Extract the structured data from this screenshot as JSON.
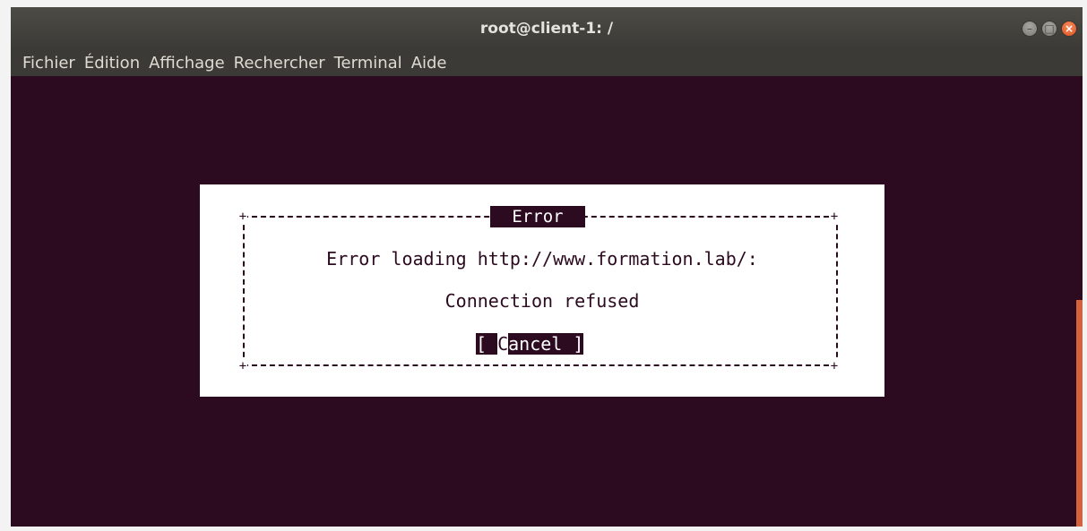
{
  "window": {
    "title": "root@client-1: /"
  },
  "menubar": {
    "items": [
      "Fichier",
      "Édition",
      "Affichage",
      "Rechercher",
      "Terminal",
      "Aide"
    ]
  },
  "dialog": {
    "title": "Error",
    "message": "Error loading http://www.formation.lab/:",
    "detail": "Connection refused",
    "button": {
      "open": "[ ",
      "hotkey": "C",
      "rest": "ancel ",
      "close": "]"
    }
  },
  "colors": {
    "terminal_bg": "#2c0a1f",
    "titlebar": "#3b3a36",
    "close_button": "#e0531e",
    "scrollbar": "#d4623a"
  },
  "icons": [
    "minimize-icon",
    "maximize-icon",
    "close-icon"
  ]
}
